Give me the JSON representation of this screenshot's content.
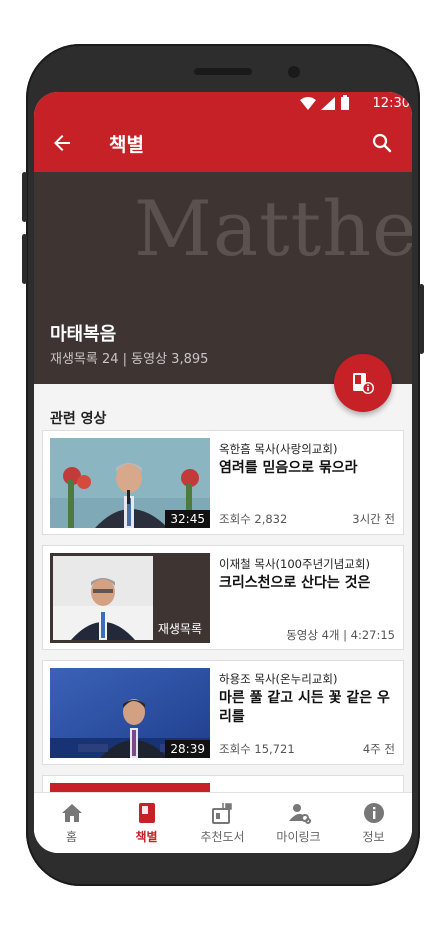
{
  "status": {
    "time": "12:30"
  },
  "appbar": {
    "title": "책별"
  },
  "book": {
    "watermark": "Matthew",
    "title": "마태복음",
    "meta": "재생목록 24  |  동영상 3,895"
  },
  "section": {
    "title": "관련 영상"
  },
  "videos": [
    {
      "preacher": "옥한흠 목사(사랑의교회)",
      "title": "염려를 믿음으로 묶으라",
      "duration": "32:45",
      "views": "조회수 2,832",
      "ago": "3시간 전"
    },
    {
      "preacher": "이재철 목사(100주년기념교회)",
      "title": "크리스천으로 산다는 것은",
      "playlist_label": "재생목록",
      "count": "동영상 4개  |  4:27:15"
    },
    {
      "preacher": "하용조 목사(온누리교회)",
      "title": "마른 풀 같고 시든 꽃 같은 우리를",
      "duration": "28:39",
      "views": "조회수 15,721",
      "ago": "4주 전"
    }
  ],
  "nav": {
    "items": [
      {
        "label": "홈",
        "icon": "home-icon"
      },
      {
        "label": "책별",
        "icon": "book-icon"
      },
      {
        "label": "추천도서",
        "icon": "recommend-icon"
      },
      {
        "label": "마이링크",
        "icon": "my-link-icon"
      },
      {
        "label": "정보",
        "icon": "info-icon"
      }
    ],
    "active": "책별"
  },
  "colors": {
    "primary": "#c62127",
    "hero_bg": "#3e3533"
  }
}
